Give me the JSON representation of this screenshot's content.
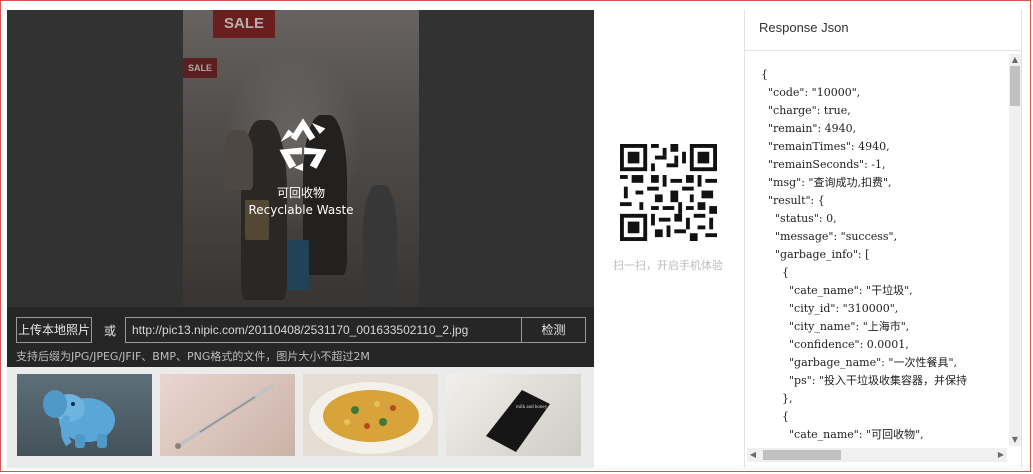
{
  "result_overlay": {
    "icon": "recycle-icon",
    "category_cn": "可回收物",
    "category_en": "Recyclable Waste"
  },
  "scene_text": {
    "sign_large": "SALE",
    "sign_small": "SALE"
  },
  "upload": {
    "button_label": "上传本地照片",
    "or_label": "或",
    "url_value": "http://pic13.nipic.com/20110408/2531170_001633502110_2.jpg",
    "detect_label": "检测",
    "hint": "支持后缀为JPG/JPEG/JFIF、BMP、PNG格式的文件，图片大小不超过2M"
  },
  "samples": [
    {
      "name": "blue-elephant-toy"
    },
    {
      "name": "thermometer"
    },
    {
      "name": "fried-rice"
    },
    {
      "name": "matchbook"
    }
  ],
  "samples_text": {
    "matchbook": "milk and honey"
  },
  "qr": {
    "icon": "qr-code-icon",
    "caption": "扫一扫，开启手机体验"
  },
  "response": {
    "title": "Response Json",
    "lines": [
      "{",
      "  \"code\": \"10000\",",
      "  \"charge\": true,",
      "  \"remain\": 4940,",
      "  \"remainTimes\": 4940,",
      "  \"remainSeconds\": -1,",
      "  \"msg\": \"查询成功,扣费\",",
      "  \"result\": {",
      "    \"status\": 0,",
      "    \"message\": \"success\",",
      "    \"garbage_info\": [",
      "      {",
      "        \"cate_name\": \"干垃圾\",",
      "        \"city_id\": \"310000\",",
      "        \"city_name\": \"上海市\",",
      "        \"confidence\": 0.0001,",
      "        \"garbage_name\": \"一次性餐具\",",
      "        \"ps\": \"投入干垃圾收集容器，并保持",
      "      },",
      "      {",
      "        \"cate_name\": \"可回收物\","
    ]
  }
}
